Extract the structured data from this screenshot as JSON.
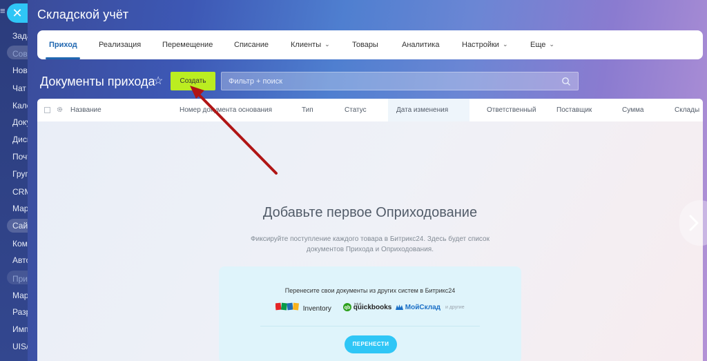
{
  "app": {
    "title": "Складской учёт"
  },
  "sidebar": {
    "close_icon": "✕",
    "items": [
      {
        "label": "Зада",
        "muted": false
      },
      {
        "label": "Совм",
        "muted": true
      },
      {
        "label": "Ново",
        "muted": false
      },
      {
        "label": "Чат и",
        "muted": false
      },
      {
        "label": "Кале",
        "muted": false
      },
      {
        "label": "Доку",
        "muted": false
      },
      {
        "label": "Диск",
        "muted": false
      },
      {
        "label": "Почт",
        "muted": false
      },
      {
        "label": "Груп",
        "muted": false
      },
      {
        "label": "CRM",
        "muted": false
      },
      {
        "label": "Мар",
        "muted": false
      },
      {
        "label": "Сайт",
        "muted": false
      },
      {
        "label": "Комг",
        "muted": false
      },
      {
        "label": "Авто",
        "muted": false
      },
      {
        "label": "Прил",
        "muted": true
      },
      {
        "label": "Мар",
        "muted": false
      },
      {
        "label": "Разр",
        "muted": false
      },
      {
        "label": "Имп",
        "muted": false
      },
      {
        "label": "UIS/C",
        "muted": false
      }
    ]
  },
  "nav": {
    "items": [
      {
        "label": "Приход",
        "active": true,
        "dropdown": false
      },
      {
        "label": "Реализация",
        "active": false,
        "dropdown": false
      },
      {
        "label": "Перемещение",
        "active": false,
        "dropdown": false
      },
      {
        "label": "Списание",
        "active": false,
        "dropdown": false
      },
      {
        "label": "Клиенты",
        "active": false,
        "dropdown": true
      },
      {
        "label": "Товары",
        "active": false,
        "dropdown": false
      },
      {
        "label": "Аналитика",
        "active": false,
        "dropdown": false
      },
      {
        "label": "Настройки",
        "active": false,
        "dropdown": true
      },
      {
        "label": "Еще",
        "active": false,
        "dropdown": true
      }
    ]
  },
  "page": {
    "title": "Документы прихода",
    "create_label": "Создать",
    "search_placeholder": "Фильтр + поиск"
  },
  "table": {
    "columns": [
      "Название",
      "Номер документа основания",
      "Тип",
      "Статус",
      "Дата изменения",
      "Ответственный",
      "Поставщик",
      "Сумма",
      "Склады"
    ]
  },
  "empty_state": {
    "title": "Добавьте первое Оприходование",
    "description": "Фиксируйте поступление каждого товара в Битрикс24. Здесь будет список документов Прихода и Оприходования.",
    "migrate_text": "Перенесите свои документы из других систем в Битрикс24",
    "logos": {
      "zoho": "ZOHO",
      "inventory": "Inventory",
      "quickbooks": "quickbooks",
      "intuit": "intuit",
      "moysklad": "МойСклад",
      "others": "и другие"
    },
    "migrate_button": "ПЕРЕНЕСТИ"
  },
  "colors": {
    "accent": "#2067b0",
    "create_button": "#bbed21",
    "migrate_button": "#2fc6f6",
    "annotation_arrow": "#b01515"
  }
}
